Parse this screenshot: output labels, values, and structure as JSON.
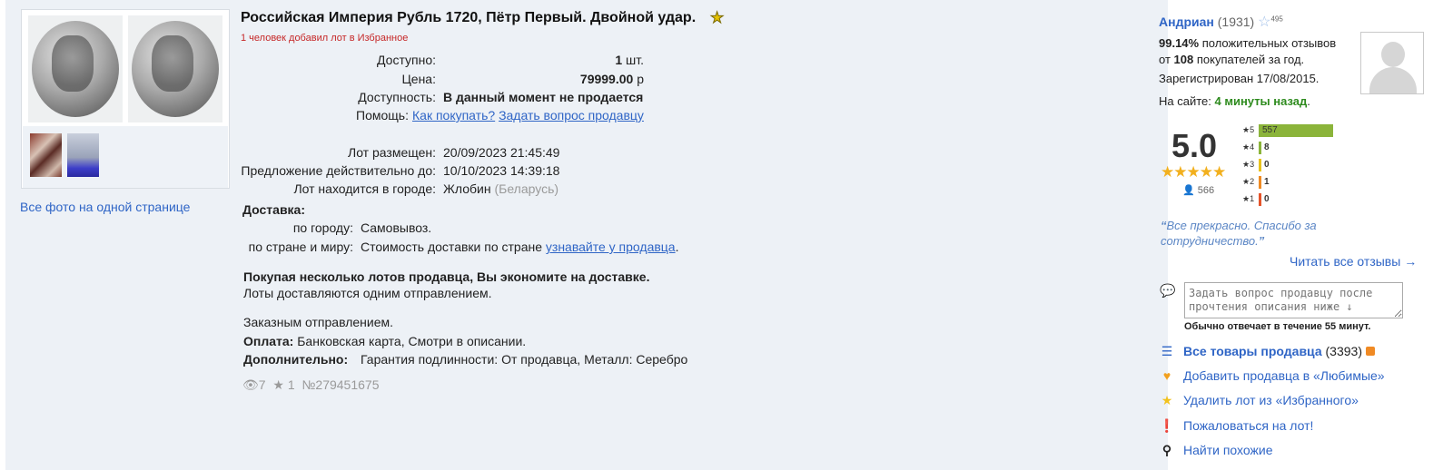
{
  "gallery": {
    "all_photos_link": "Все фото на одной странице"
  },
  "lot": {
    "title": "Российская Империя Рубль 1720, Пётр Первый. Двойной удар.",
    "favorites_note": "1 человек добавил лот в Избранное",
    "available_label": "Доступно:",
    "available_count": "1",
    "available_unit": "шт.",
    "price_label": "Цена:",
    "price_value": "79999.00",
    "price_currency": "р",
    "availability_label": "Доступность:",
    "availability_value": "В данный момент не продается",
    "help_label": "Помощь:",
    "help_link1": "Как покупать?",
    "help_link2": "Задать вопрос продавцу",
    "posted_label": "Лот размещен:",
    "posted_value": "20/09/2023 21:45:49",
    "valid_label": "Предложение действительно до:",
    "valid_value": "10/10/2023 14:39:18",
    "city_label": "Лот находится в городе:",
    "city_value": "Жлобин",
    "city_country": "(Беларусь)",
    "delivery_label": "Доставка:",
    "delivery_city_label": "по городу:",
    "delivery_city_value": "Самовывоз.",
    "delivery_world_label": "по стране и миру:",
    "delivery_world_value": "Стоимость доставки по стране",
    "delivery_world_link": "узнавайте у продавца",
    "delivery_world_end": ".",
    "bundle_title": "Покупая несколько лотов продавца, Вы экономите на доставке.",
    "bundle_text": "Лоты доставляются одним отправлением.",
    "registered_mail": "Заказным отправлением.",
    "payment_label": "Оплата:",
    "payment_value": "Банковская карта, Смотри в описании.",
    "extra_label": "Дополнительно:",
    "extra_value": "Гарантия подлинности: От продавца, Металл: Серебро",
    "views": "7",
    "stars": "1",
    "lot_number": "№279451675"
  },
  "seller": {
    "name": "Андриан",
    "count": "(1931)",
    "star_badge": "495",
    "positive_percent": "99.14%",
    "positive_text": "положительных отзывов",
    "from_text": "от",
    "buyers_count": "108",
    "buyers_text": "покупателей за год.",
    "registered": "Зарегистрирован 17/08/2015.",
    "online_label": "На сайте:",
    "online_value": "4 минуты назад",
    "online_end": ".",
    "rating": "5.0",
    "rating_stars": "★★★★★",
    "reviewers": "566",
    "rating_bars": [
      {
        "label": "★5",
        "count": "557",
        "share": 1.0,
        "color": "#8bb43a"
      },
      {
        "label": "★4",
        "count": "8",
        "share": 0.014,
        "color": "#8bb43a"
      },
      {
        "label": "★3",
        "count": "0",
        "share": 0.0,
        "color": "#e8c21c"
      },
      {
        "label": "★2",
        "count": "1",
        "share": 0.002,
        "color": "#ef8a22"
      },
      {
        "label": "★1",
        "count": "0",
        "share": 0.0,
        "color": "#e5542a"
      }
    ],
    "quote": "Все прекрасно. Спасибо за сотрудничество.",
    "read_all": "Читать все отзывы →",
    "question_placeholder": "Задать вопрос продавцу после прочтения описания ниже ↓",
    "reply_time": "Обычно отвечает в течение 55 минут.",
    "all_items_label": "Все товары продавца",
    "all_items_count": "(3393)",
    "add_favorite": "Добавить продавца в «Любимые»",
    "remove_favorite": "Удалить лот из «Избранного»",
    "report": "Пожаловаться на лот!",
    "find_similar": "Найти похожие"
  },
  "colors": {
    "link": "#2f65c6",
    "online_green": "#2e8b1e",
    "alert_red": "#c62828",
    "rating_star": "#f2b01e"
  }
}
